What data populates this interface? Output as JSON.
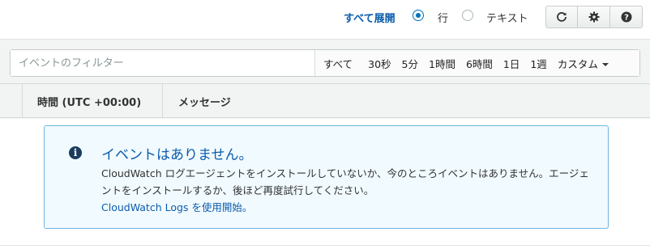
{
  "toolbar": {
    "expand_all_label": "すべて展開",
    "view_mode_options": [
      {
        "label": "行",
        "selected": true
      },
      {
        "label": "テキスト",
        "selected": false
      }
    ],
    "buttons": [
      {
        "icon": "refresh-icon"
      },
      {
        "icon": "gear-icon"
      },
      {
        "icon": "help-icon"
      }
    ]
  },
  "filter": {
    "placeholder": "イベントのフィルター",
    "value": "",
    "time_ranges": [
      "すべて",
      "30秒",
      "5分",
      "1時間",
      "6時間",
      "1日",
      "1週"
    ],
    "custom_label": "カスタム"
  },
  "table": {
    "columns": [
      "時間 (UTC +00:00)",
      "メッセージ"
    ]
  },
  "empty_state": {
    "title": "イベントはありません。",
    "body": "CloudWatch ログエージェントをインストールしていないか、今のところイベントはありません。エージェントをインストールするか、後ほど再度試行してください。",
    "link_text": "CloudWatch Logs を使用開始。"
  },
  "colors": {
    "link": "#0b5cab",
    "info_border": "#73b6e0",
    "info_background": "#f1faff",
    "band_background": "#f2f3f3"
  }
}
